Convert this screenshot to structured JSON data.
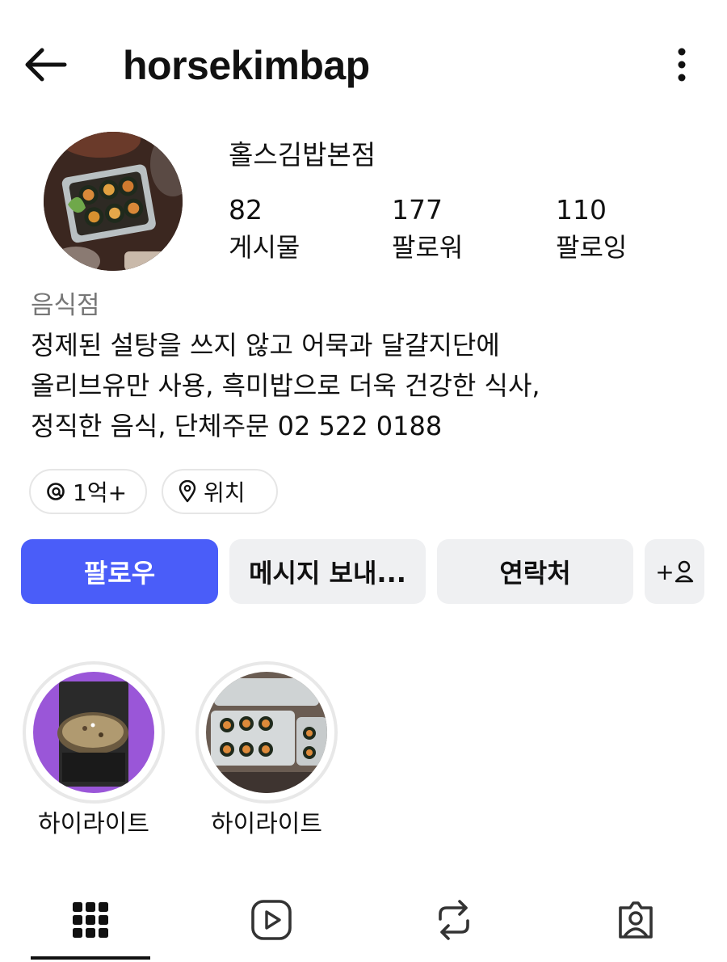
{
  "header": {
    "username": "horsekimbap",
    "back_icon": "arrow-left-icon",
    "more_icon": "vertical-dots-icon"
  },
  "profile": {
    "display_name": "홀스김밥본점",
    "stats": [
      {
        "count": "82",
        "label": "게시물"
      },
      {
        "count": "177",
        "label": "팔로워"
      },
      {
        "count": "110",
        "label": "팔로잉"
      }
    ],
    "category": "음식점",
    "bio_lines": [
      "정제된 설탕을 쓰지 않고 어묵과 달걀지단에",
      "올리브유만 사용, 흑미밥으로 더욱 건강한 식사,",
      "정직한 음식,  단체주문 02 522 0188"
    ]
  },
  "chips": [
    {
      "icon": "threads-icon",
      "label": "1억+"
    },
    {
      "icon": "location-pin-icon",
      "label": "위치"
    }
  ],
  "actions": {
    "follow_label": "팔로우",
    "message_label": "메시지 보내...",
    "contact_label": "연락처",
    "add_user_label": "+",
    "accent": "#4a5df9"
  },
  "highlights": [
    {
      "label": "하이라이트"
    },
    {
      "label": "하이라이트"
    }
  ],
  "tabs": [
    {
      "icon": "grid-icon",
      "active": true
    },
    {
      "icon": "reels-icon",
      "active": false
    },
    {
      "icon": "repost-icon",
      "active": false
    },
    {
      "icon": "tagged-icon",
      "active": false
    }
  ]
}
